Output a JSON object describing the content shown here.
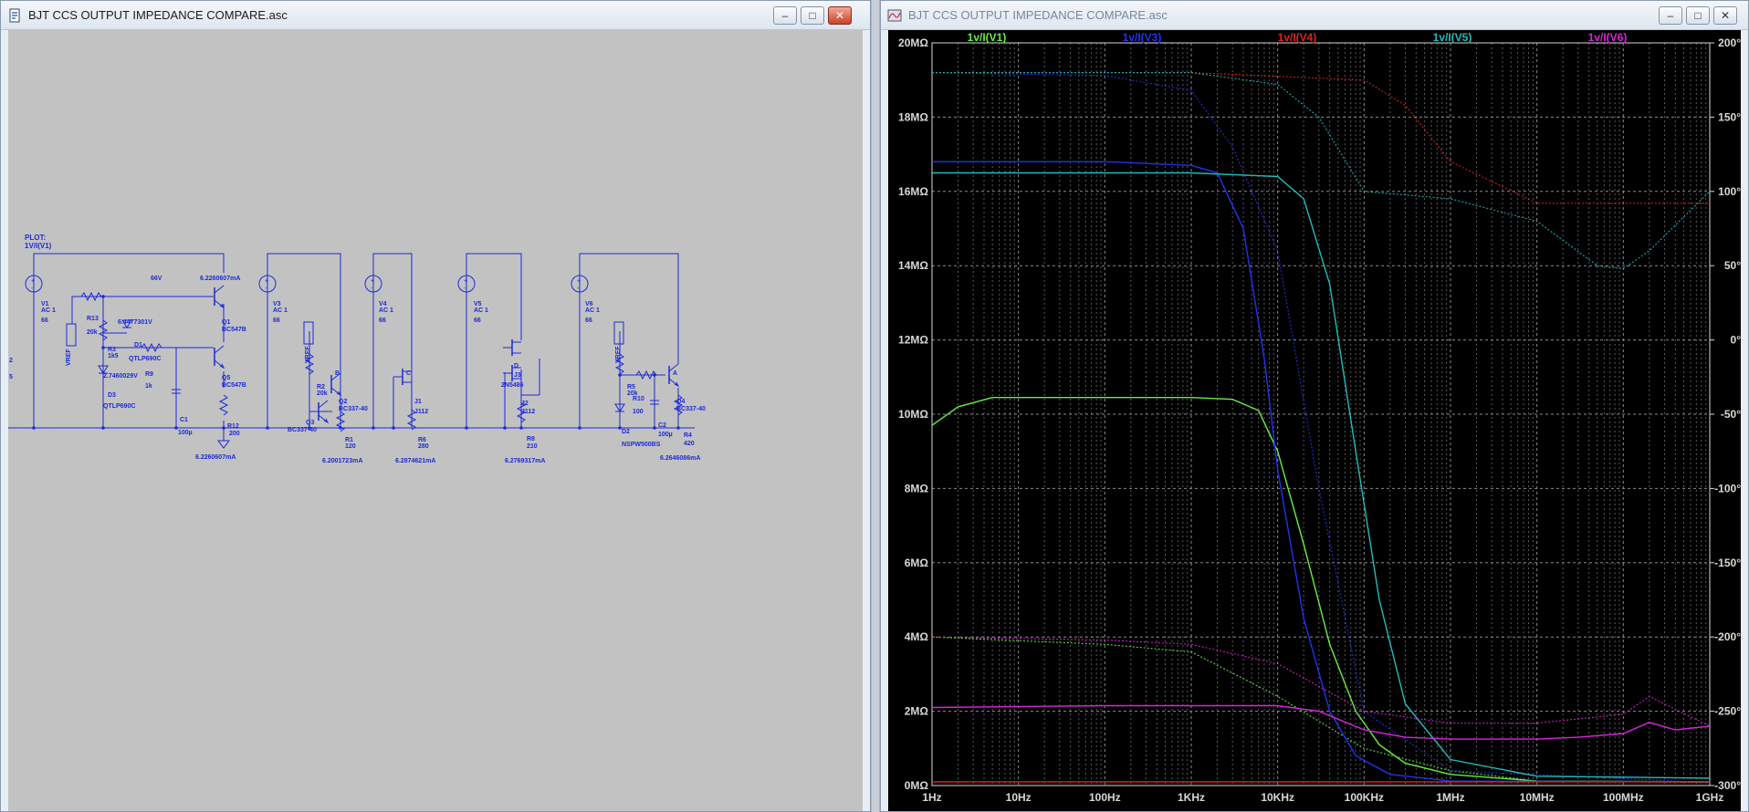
{
  "schematic_window": {
    "title": "BJT CCS OUTPUT IMPEDANCE COMPARE.asc",
    "buttons": {
      "minimize": "–",
      "maximize": "□",
      "close": "✕"
    },
    "icon": "ltspice-schematic-icon",
    "plot_directive": [
      "PLOT:",
      "1V/I(V1)"
    ],
    "edge_labels": [
      "2",
      "5"
    ],
    "labels": [
      {
        "id": "V1",
        "text": "V1"
      },
      {
        "id": "V1ac",
        "text": "AC 1"
      },
      {
        "id": "V1v",
        "text": "66"
      },
      {
        "id": "n66",
        "text": "66V"
      },
      {
        "id": "iq1",
        "text": "6.2260607mA"
      },
      {
        "id": "R13",
        "text": "R13"
      },
      {
        "id": "R13v",
        "text": "20k"
      },
      {
        "id": "nq1b",
        "text": "6.4477301V"
      },
      {
        "id": "Q1",
        "text": "Q1"
      },
      {
        "id": "Q1m",
        "text": "BC547B"
      },
      {
        "id": "VREF1",
        "text": "VREF"
      },
      {
        "id": "R3",
        "text": "R3"
      },
      {
        "id": "R3v",
        "text": "1k5"
      },
      {
        "id": "D1",
        "text": "D1"
      },
      {
        "id": "D1m",
        "text": "QTLP690C"
      },
      {
        "id": "nd",
        "text": "2.7460029V"
      },
      {
        "id": "R9",
        "text": "R9"
      },
      {
        "id": "R9v",
        "text": "1k"
      },
      {
        "id": "Q5",
        "text": "Q5"
      },
      {
        "id": "Q5m",
        "text": "BC547B"
      },
      {
        "id": "D3",
        "text": "D3"
      },
      {
        "id": "D3m",
        "text": "QTLP690C"
      },
      {
        "id": "C1",
        "text": "C1"
      },
      {
        "id": "C1v",
        "text": "100µ"
      },
      {
        "id": "R12",
        "text": "R12"
      },
      {
        "id": "R12v",
        "text": "200"
      },
      {
        "id": "ibot1",
        "text": "6.2260607mA"
      },
      {
        "id": "V3",
        "text": "V3"
      },
      {
        "id": "V3ac",
        "text": "AC 1"
      },
      {
        "id": "V3v",
        "text": "66"
      },
      {
        "id": "VREF2",
        "text": "VREF"
      },
      {
        "id": "R2",
        "text": "R2"
      },
      {
        "id": "R2v",
        "text": "20k"
      },
      {
        "id": "B",
        "text": "B"
      },
      {
        "id": "Q2",
        "text": "Q2"
      },
      {
        "id": "Q2m",
        "text": "BC337-40"
      },
      {
        "id": "Q3",
        "text": "Q3"
      },
      {
        "id": "Q3m",
        "text": "BC337-40"
      },
      {
        "id": "R1",
        "text": "R1"
      },
      {
        "id": "R1v",
        "text": "120"
      },
      {
        "id": "ibot2",
        "text": "6.2001723mA"
      },
      {
        "id": "V4",
        "text": "V4"
      },
      {
        "id": "V4ac",
        "text": "AC 1"
      },
      {
        "id": "V4v",
        "text": "66"
      },
      {
        "id": "C",
        "text": "C"
      },
      {
        "id": "J1",
        "text": "J1"
      },
      {
        "id": "J1m",
        "text": "J112"
      },
      {
        "id": "R6",
        "text": "R6"
      },
      {
        "id": "R6v",
        "text": "280"
      },
      {
        "id": "ibot3",
        "text": "6.2874621mA"
      },
      {
        "id": "V5",
        "text": "V5"
      },
      {
        "id": "V5ac",
        "text": "AC 1"
      },
      {
        "id": "V5v",
        "text": "66"
      },
      {
        "id": "D",
        "text": "D"
      },
      {
        "id": "J3",
        "text": "J3"
      },
      {
        "id": "J3m",
        "text": "2N5486"
      },
      {
        "id": "J2",
        "text": "J2"
      },
      {
        "id": "J2m",
        "text": "J112"
      },
      {
        "id": "R8",
        "text": "R8"
      },
      {
        "id": "R8v",
        "text": "210"
      },
      {
        "id": "ibot4",
        "text": "6.2769317mA"
      },
      {
        "id": "V6",
        "text": "V6"
      },
      {
        "id": "V6ac",
        "text": "AC 1"
      },
      {
        "id": "V6v",
        "text": "66"
      },
      {
        "id": "VREF3",
        "text": "VREF"
      },
      {
        "id": "R5",
        "text": "R5"
      },
      {
        "id": "R5v",
        "text": "20k"
      },
      {
        "id": "R10",
        "text": "R10"
      },
      {
        "id": "R10v",
        "text": "100"
      },
      {
        "id": "A",
        "text": "A"
      },
      {
        "id": "Q4",
        "text": "Q4"
      },
      {
        "id": "Q4m",
        "text": "BC337-40"
      },
      {
        "id": "D2",
        "text": "D2"
      },
      {
        "id": "D2m",
        "text": "NSPW500BS"
      },
      {
        "id": "C2",
        "text": "C2"
      },
      {
        "id": "C2v",
        "text": "100µ"
      },
      {
        "id": "R4",
        "text": "R4"
      },
      {
        "id": "R4v",
        "text": "420"
      },
      {
        "id": "ibot5",
        "text": "6.2646086mA"
      }
    ]
  },
  "plot_window": {
    "title": "BJT CCS OUTPUT IMPEDANCE COMPARE.asc",
    "buttons": {
      "minimize": "–",
      "maximize": "□",
      "close": "✕"
    },
    "icon": "waveform-viewer-icon",
    "background": "#000000",
    "grid": true
  },
  "chart_data": {
    "type": "line",
    "x_scale": "log",
    "xlim": [
      "1Hz",
      "1GHz"
    ],
    "x_ticks": [
      "1Hz",
      "10Hz",
      "100Hz",
      "1KHz",
      "10KHz",
      "100KHz",
      "1MHz",
      "10MHz",
      "100MHz",
      "1GHz"
    ],
    "y_ticks_left": [
      "0MΩ",
      "2MΩ",
      "4MΩ",
      "6MΩ",
      "8MΩ",
      "10MΩ",
      "12MΩ",
      "14MΩ",
      "16MΩ",
      "18MΩ",
      "20MΩ"
    ],
    "ylim_left_MOhm": [
      0,
      20
    ],
    "y_ticks_right": [
      "-300°",
      "-250°",
      "-200°",
      "-150°",
      "-100°",
      "-50°",
      "0°",
      "50°",
      "100°",
      "150°",
      "200°"
    ],
    "ylim_right_deg": [
      -300,
      200
    ],
    "legend_placement": "top",
    "series": [
      {
        "name": "1v/I(V1)",
        "color": "#66ee44",
        "magnitude": [
          [
            1,
            9.7
          ],
          [
            2,
            10.2
          ],
          [
            5,
            10.45
          ],
          [
            1000,
            10.45
          ],
          [
            3000,
            10.4
          ],
          [
            6000,
            10.1
          ],
          [
            10000,
            9.0
          ],
          [
            20000,
            6.5
          ],
          [
            40000,
            3.8
          ],
          [
            80000,
            2.0
          ],
          [
            150000,
            1.1
          ],
          [
            300000,
            0.6
          ],
          [
            1000000,
            0.3
          ],
          [
            10000000,
            0.12
          ],
          [
            1000000000,
            0.1
          ]
        ],
        "phase": [
          [
            1,
            -200
          ],
          [
            100,
            -205
          ],
          [
            1000,
            -210
          ],
          [
            10000,
            -240
          ],
          [
            100000,
            -275
          ],
          [
            1000000,
            -290
          ],
          [
            10000000,
            -297
          ],
          [
            1000000000,
            -298
          ]
        ]
      },
      {
        "name": "1v/I(V3)",
        "color": "#2233ee",
        "magnitude": [
          [
            1,
            16.8
          ],
          [
            100,
            16.8
          ],
          [
            1000,
            16.7
          ],
          [
            2000,
            16.5
          ],
          [
            4000,
            15.0
          ],
          [
            7000,
            11.5
          ],
          [
            10000,
            8.5
          ],
          [
            20000,
            4.5
          ],
          [
            40000,
            2.0
          ],
          [
            80000,
            0.8
          ],
          [
            200000,
            0.3
          ],
          [
            1000000,
            0.12
          ],
          [
            1000000000,
            0.1
          ]
        ],
        "phase": [
          [
            1,
            180
          ],
          [
            100,
            178
          ],
          [
            1000,
            168
          ],
          [
            3000,
            130
          ],
          [
            10000,
            60
          ],
          [
            30000,
            -100
          ],
          [
            100000,
            -250
          ],
          [
            1000000,
            -290
          ],
          [
            1000000000,
            -298
          ]
        ]
      },
      {
        "name": "1v/I(V4)",
        "color": "#dd2222",
        "magnitude": [
          [
            1,
            0.1
          ],
          [
            1000000000,
            0.1
          ]
        ],
        "phase": [
          [
            1,
            180
          ],
          [
            1000,
            180
          ],
          [
            100000,
            175
          ],
          [
            300000,
            158
          ],
          [
            1000000,
            120
          ],
          [
            10000000,
            92
          ],
          [
            1000000000,
            92
          ]
        ]
      },
      {
        "name": "1v/I(V5)",
        "color": "#22bbbb",
        "magnitude": [
          [
            1,
            16.5
          ],
          [
            1000,
            16.5
          ],
          [
            10000,
            16.4
          ],
          [
            20000,
            15.8
          ],
          [
            40000,
            13.5
          ],
          [
            80000,
            9.0
          ],
          [
            150000,
            5.0
          ],
          [
            300000,
            2.2
          ],
          [
            1000000,
            0.7
          ],
          [
            10000000,
            0.25
          ],
          [
            1000000000,
            0.2
          ]
        ],
        "phase": [
          [
            1,
            180
          ],
          [
            1000,
            180
          ],
          [
            10000,
            172
          ],
          [
            30000,
            150
          ],
          [
            100000,
            100
          ],
          [
            1000000,
            95
          ],
          [
            10000000,
            80
          ],
          [
            50000000,
            50
          ],
          [
            100000000,
            48
          ],
          [
            200000000,
            60
          ],
          [
            1000000000,
            100
          ]
        ]
      },
      {
        "name": "1v/I(V6)",
        "color": "#dd22dd",
        "magnitude": [
          [
            1,
            2.1
          ],
          [
            100,
            2.15
          ],
          [
            10000,
            2.15
          ],
          [
            30000,
            2.0
          ],
          [
            100000,
            1.5
          ],
          [
            300000,
            1.3
          ],
          [
            1000000,
            1.25
          ],
          [
            10000000,
            1.25
          ],
          [
            30000000,
            1.3
          ],
          [
            100000000,
            1.4
          ],
          [
            200000000,
            1.7
          ],
          [
            400000000,
            1.5
          ],
          [
            1000000000,
            1.6
          ]
        ],
        "phase": [
          [
            1,
            -200
          ],
          [
            100,
            -202
          ],
          [
            1000,
            -205
          ],
          [
            10000,
            -218
          ],
          [
            100000,
            -250
          ],
          [
            1000000,
            -258
          ],
          [
            10000000,
            -258
          ],
          [
            100000000,
            -252
          ],
          [
            200000000,
            -240
          ],
          [
            1000000000,
            -260
          ]
        ]
      }
    ]
  }
}
